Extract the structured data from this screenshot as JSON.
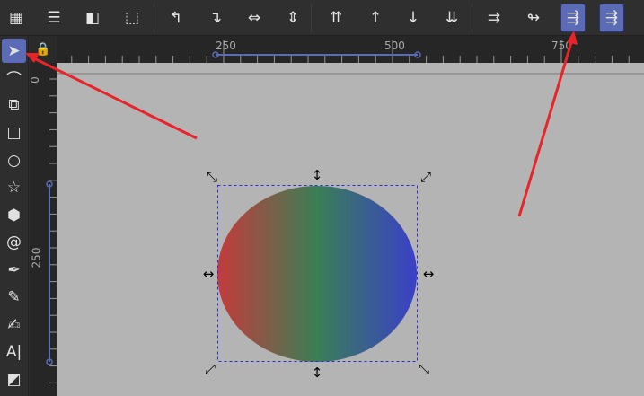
{
  "toolbar": {
    "buttons": [
      {
        "name": "group-button",
        "icon": "▦"
      },
      {
        "name": "ungroup-button",
        "icon": "☰"
      },
      {
        "name": "clip-button",
        "icon": "◧"
      },
      {
        "name": "pop-selection-button",
        "icon": "⬚"
      },
      {
        "name": "rotate-ccw-button",
        "icon": "↰"
      },
      {
        "name": "rotate-cw-button",
        "icon": "↴"
      },
      {
        "name": "flip-horizontal-button",
        "icon": "⇔"
      },
      {
        "name": "flip-vertical-button",
        "icon": "⇕"
      },
      {
        "name": "raise-to-top-button",
        "icon": "⇈"
      },
      {
        "name": "raise-button",
        "icon": "↑"
      },
      {
        "name": "lower-button",
        "icon": "↓"
      },
      {
        "name": "lower-to-bottom-button",
        "icon": "⇊"
      },
      {
        "name": "scale-stroke-button",
        "icon": "⇉"
      },
      {
        "name": "scale-corners-button",
        "icon": "↬"
      },
      {
        "name": "transform-gradients-button",
        "icon": "⇶"
      },
      {
        "name": "transform-patterns-button",
        "icon": "⇶"
      }
    ],
    "overflow": "›"
  },
  "tools": [
    {
      "name": "selector-tool",
      "icon": "➤"
    },
    {
      "name": "node-tool",
      "icon": "⌒"
    },
    {
      "name": "shape-builder-tool",
      "icon": "⧉"
    },
    {
      "name": "rectangle-tool",
      "icon": "□"
    },
    {
      "name": "ellipse-tool",
      "icon": "○"
    },
    {
      "name": "star-tool",
      "icon": "☆"
    },
    {
      "name": "3d-box-tool",
      "icon": "⬢"
    },
    {
      "name": "spiral-tool",
      "icon": "@"
    },
    {
      "name": "pen-tool",
      "icon": "✒"
    },
    {
      "name": "pencil-tool",
      "icon": "✎"
    },
    {
      "name": "calligraphy-tool",
      "icon": "✍"
    },
    {
      "name": "text-tool",
      "icon": "A|"
    },
    {
      "name": "gradient-tool",
      "icon": "◩"
    }
  ],
  "lock_icon": "🔒",
  "rulers": {
    "h": [
      "250",
      "500",
      "750"
    ],
    "v": [
      "0",
      "250"
    ]
  },
  "colors": {
    "accent": "#5b6bb5",
    "gradient": [
      "#c43b3b",
      "#3a7f55",
      "#3a40c8"
    ],
    "annotation": "#e8242a"
  }
}
